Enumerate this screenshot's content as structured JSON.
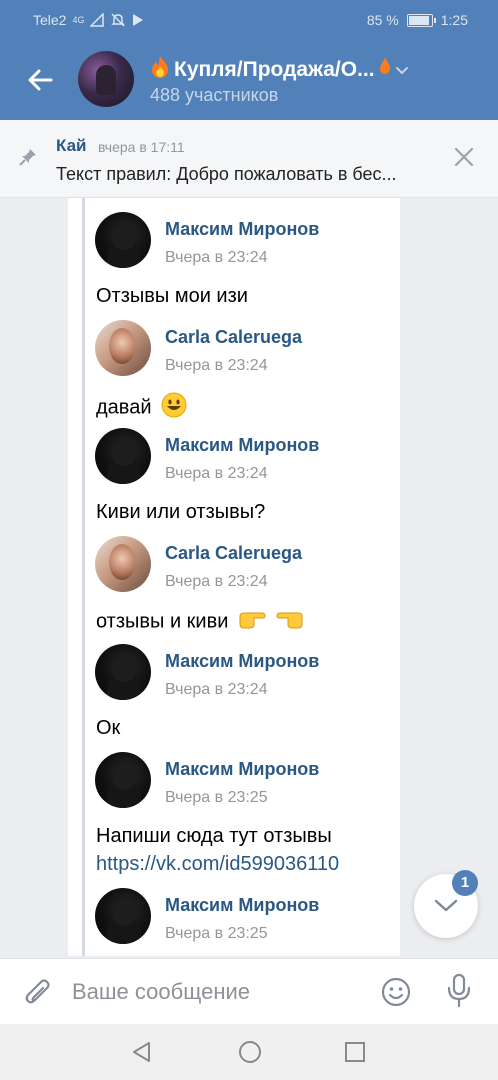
{
  "status_bar": {
    "carrier": "Tele2",
    "network": "4G",
    "battery": "85 %",
    "battery_level": 0.85,
    "time": "1:25"
  },
  "header": {
    "title": "Купля/Продажа/О...",
    "members": "488 участников"
  },
  "pinned": {
    "author": "Кай",
    "time": "вчера в 17:11",
    "text": "Текст правил: Добро пожаловать в бес..."
  },
  "messages": [
    {
      "author": "Максим Миронов",
      "avatar": "maksim-avatar",
      "time": "Вчера в 23:24",
      "text": "Отзывы мои изи"
    },
    {
      "author": "Carla Caleruega",
      "avatar": "carla-avatar",
      "time": "Вчера в 23:24",
      "text": "давай"
    },
    {
      "author": "Максим Миронов",
      "avatar": "maksim-avatar",
      "time": "Вчера в 23:24",
      "text": "Киви или отзывы?"
    },
    {
      "author": "Carla Caleruega",
      "avatar": "carla-avatar",
      "time": "Вчера в 23:24",
      "text": "отзывы и киви"
    },
    {
      "author": "Максим Миронов",
      "avatar": "maksim-avatar",
      "time": "Вчера в 23:24",
      "text": "Ок"
    },
    {
      "author": "Максим Миронов",
      "avatar": "maksim-avatar",
      "time": "Вчера в 23:25",
      "text": "Напиши сюда тут отзывы",
      "link": "https://vk.com/id599036110"
    },
    {
      "author": "Максим Миронов",
      "avatar": "maksim-avatar",
      "time": "Вчера в 23:25",
      "text": ""
    }
  ],
  "scroll_down": {
    "badge": "1"
  },
  "composer": {
    "placeholder": "Ваше сообщение"
  },
  "colors": {
    "accent": "#5181b8",
    "name": "#2a5885",
    "muted": "#939699"
  }
}
